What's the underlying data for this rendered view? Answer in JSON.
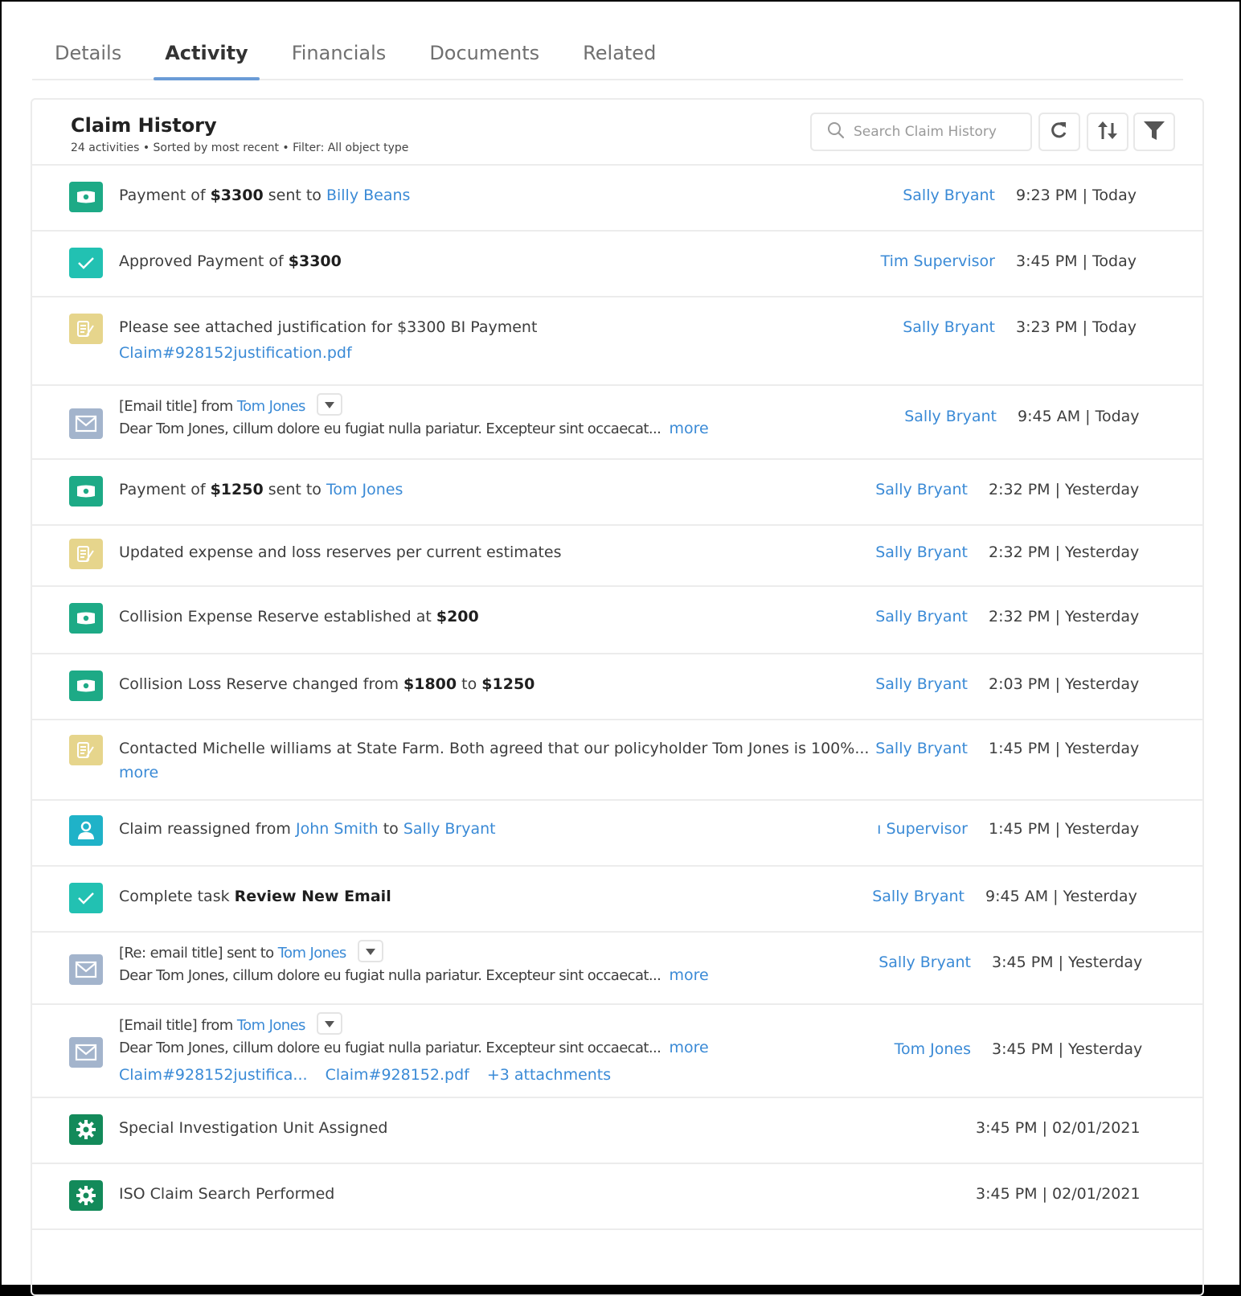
{
  "tabs": [
    {
      "label": "Details",
      "active": false
    },
    {
      "label": "Activity",
      "active": true
    },
    {
      "label": "Financials",
      "active": false
    },
    {
      "label": "Documents",
      "active": false
    },
    {
      "label": "Related",
      "active": false
    }
  ],
  "header": {
    "title": "Claim History",
    "subtitle": "24 activities • Sorted by most recent • Filter: All object type",
    "search_placeholder": "Search Claim History",
    "search_value": "",
    "buttons": {
      "refresh": "refresh-icon",
      "sort": "sort-icon",
      "filter": "filter-icon"
    }
  },
  "colors": {
    "link": "#3a8ad6",
    "active_tab_underline": "#6a9bd6",
    "money_icon": "#1daa86",
    "check_icon": "#22c1b2",
    "note_icon": "#e6d58c",
    "mail_icon": "#a3b4cc",
    "user_icon": "#1fb2c8",
    "gear_icon": "#138a5a"
  },
  "activities": [
    {
      "icon": "money-icon",
      "pre": "Payment of ",
      "bold": "$3300",
      "mid": " sent to ",
      "link": "Billy Beans",
      "user": "Sally Bryant",
      "time": "9:23 PM | Today"
    },
    {
      "icon": "check-icon",
      "pre": "Approved Payment of ",
      "bold": "$3300",
      "user": "Tim Supervisor",
      "time": "3:45 PM | Today"
    },
    {
      "icon": "note-icon",
      "pre": "Please see attached justification for $3300 BI Payment",
      "attachment": "Claim#928152justification.pdf",
      "user": "Sally Bryant",
      "time": "3:23 PM | Today"
    },
    {
      "icon": "mail-icon",
      "pre": "[Email title] from ",
      "link": "Tom Jones",
      "body": "Dear Tom Jones, cillum dolore eu fugiat nulla pariatur. Excepteur sint occaecat...",
      "more": "more",
      "user": "Sally Bryant",
      "time": "9:45 AM | Today"
    },
    {
      "icon": "money-icon",
      "pre": "Payment of ",
      "bold": "$1250",
      "mid": " sent to ",
      "link": "Tom Jones",
      "user": "Sally Bryant",
      "time": "2:32 PM | Yesterday"
    },
    {
      "icon": "note-icon",
      "pre": "Updated expense and loss reserves per current estimates",
      "user": "Sally Bryant",
      "time": "2:32 PM | Yesterday"
    },
    {
      "icon": "money-icon",
      "pre": "Collision Expense Reserve established at ",
      "bold": "$200",
      "user": "Sally Bryant",
      "time": "2:32 PM | Yesterday"
    },
    {
      "icon": "money-icon",
      "pre": "Collision Loss Reserve changed from ",
      "bold": "$1800",
      "mid": " to ",
      "bold2": "$1250",
      "user": "Sally Bryant",
      "time": "2:03 PM | Yesterday"
    },
    {
      "icon": "note-icon",
      "pre": "Contacted Michelle williams at State Farm. Both agreed that our policyholder Tom Jones is 100%...",
      "more": "more",
      "user": "Sally Bryant",
      "time": "1:45 PM | Yesterday"
    },
    {
      "icon": "user-icon",
      "pre": "Claim reassigned from ",
      "link": "John Smith",
      "mid": " to ",
      "link2": "Sally Bryant",
      "user": "ı Supervisor",
      "time": "1:45 PM | Yesterday"
    },
    {
      "icon": "check-icon",
      "pre": "Complete task ",
      "bold": "Review New Email",
      "user": "Sally Bryant",
      "time": "9:45 AM | Yesterday"
    },
    {
      "icon": "mail-icon",
      "pre": "[Re: email title] sent to ",
      "link": "Tom Jones",
      "body": "Dear Tom Jones, cillum dolore eu fugiat nulla pariatur. Excepteur sint occaecat...",
      "more": "more",
      "user": "Sally Bryant",
      "time": "3:45 PM | Yesterday"
    },
    {
      "icon": "mail-icon",
      "pre": "[Email title] from ",
      "link": "Tom Jones",
      "body": "Dear Tom Jones, cillum dolore eu fugiat nulla pariatur. Excepteur sint occaecat...",
      "more": "more",
      "attachments": [
        "Claim#928152justifica...",
        "Claim#928152.pdf",
        "+3 attachments"
      ],
      "user": "Tom Jones",
      "time": "3:45 PM | Yesterday"
    },
    {
      "icon": "gear-icon",
      "pre": "Special Investigation Unit Assigned",
      "time": "3:45 PM | 02/01/2021"
    },
    {
      "icon": "gear-icon",
      "pre": "ISO Claim Search Performed",
      "time": "3:45 PM | 02/01/2021"
    }
  ]
}
